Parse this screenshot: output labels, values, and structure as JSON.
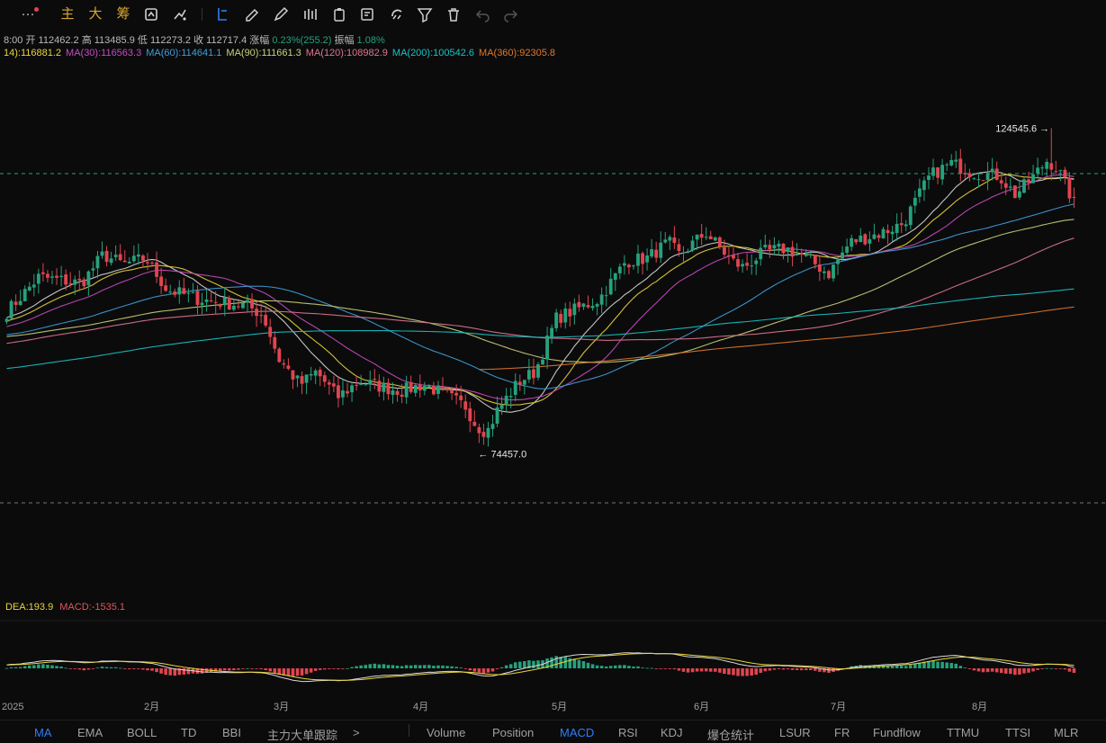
{
  "toolbar": {
    "items": [
      {
        "name": "more-menu",
        "label": "···"
      },
      {
        "name": "main-indicator",
        "label": "主"
      },
      {
        "name": "big-order",
        "label": "大"
      },
      {
        "name": "chip-distribution",
        "label": "筹"
      }
    ],
    "icons": [
      "compare-icon",
      "indicator-icon",
      "cursor-icon",
      "ruler-icon",
      "pen-icon",
      "pattern-icon",
      "clipboard-icon",
      "note-icon",
      "magnet-icon",
      "filter-icon",
      "trash-icon",
      "undo-icon",
      "redo-icon"
    ]
  },
  "ohlc": {
    "time": "8:00",
    "open_label": "开",
    "open": "112462.2",
    "high_label": "高",
    "high": "113485.9",
    "low_label": "低",
    "low": "112273.2",
    "close_label": "收",
    "close": "112717.4",
    "change_label": "涨幅",
    "change": "0.23%(255.2)",
    "amp_label": "振幅",
    "amp": "1.08%"
  },
  "ma_legend": [
    {
      "text": "14):116881.2",
      "color": "#e8d63a"
    },
    {
      "text": "MA(30):116563.3",
      "color": "#c84bc0"
    },
    {
      "text": "MA(60):114641.1",
      "color": "#3f9fd8"
    },
    {
      "text": "MA(90):111661.3",
      "color": "#c9d27a"
    },
    {
      "text": "MA(120):108982.9",
      "color": "#e0758f"
    },
    {
      "text": "MA(200):100542.6",
      "color": "#18c4c4"
    },
    {
      "text": "MA(360):92305.8",
      "color": "#e0782c"
    }
  ],
  "macd_legend": {
    "dea": "DEA:193.9",
    "dea_color": "#e8d63a",
    "macd": "MACD:-1535.1",
    "macd_color": "#e0555a"
  },
  "annotations": {
    "high": "124545.6",
    "low": "74457.0"
  },
  "x_axis": {
    "labels": [
      "2025",
      "2月",
      "3月",
      "4月",
      "5月",
      "6月",
      "7月",
      "8月"
    ]
  },
  "bottom_tabs_left": [
    {
      "label": "MA",
      "active": true
    },
    {
      "label": "EMA",
      "active": false
    },
    {
      "label": "BOLL",
      "active": false
    },
    {
      "label": "TD",
      "active": false
    },
    {
      "label": "BBI",
      "active": false
    },
    {
      "label": "主力大单跟踪",
      "active": false
    },
    {
      "label": ">",
      "active": false
    }
  ],
  "bottom_tabs_right": [
    {
      "label": "Volume",
      "active": false
    },
    {
      "label": "Position",
      "active": false
    },
    {
      "label": "MACD",
      "active": true
    },
    {
      "label": "RSI",
      "active": false
    },
    {
      "label": "KDJ",
      "active": false
    },
    {
      "label": "爆仓统计",
      "active": false
    },
    {
      "label": "LSUR",
      "active": false
    },
    {
      "label": "FR",
      "active": false
    },
    {
      "label": "Fundflow",
      "active": false
    },
    {
      "label": "TTMU",
      "active": false
    },
    {
      "label": "TTSI",
      "active": false
    },
    {
      "label": "MLR",
      "active": false
    }
  ],
  "colors": {
    "up": "#26a17b",
    "down": "#e0454f",
    "background": "#0b0b0c",
    "macd_line": "#d9d9d9",
    "signal_line": "#e8d63a"
  },
  "chart_data": {
    "type": "candlestick",
    "title": "",
    "x": [
      "2025-01",
      "2025-02",
      "2025-03",
      "2025-04",
      "2025-05",
      "2025-06",
      "2025-07",
      "2025-08"
    ],
    "price_anchors": [
      {
        "month": "2025-01",
        "close": 94000
      },
      {
        "month": "2025-01 late",
        "close": 104000
      },
      {
        "month": "2025-02",
        "close": 98000
      },
      {
        "month": "2025-03",
        "close": 84000
      },
      {
        "month": "2025-04",
        "close": 83000
      },
      {
        "month": "2025-04 min",
        "close": 74457
      },
      {
        "month": "2025-05",
        "close": 97000
      },
      {
        "month": "2025-05 late",
        "close": 109000
      },
      {
        "month": "2025-06",
        "close": 105000
      },
      {
        "month": "2025-07",
        "close": 108000
      },
      {
        "month": "2025-07 mid",
        "close": 119000
      },
      {
        "month": "2025-08",
        "close": 115000
      },
      {
        "month": "2025-08 peak",
        "close": 124545.6
      },
      {
        "month": "2025-08 last",
        "close": 112717.4
      }
    ],
    "series": [
      {
        "name": "MA(30)",
        "latest": 116563.3
      },
      {
        "name": "MA(60)",
        "latest": 114641.1
      },
      {
        "name": "MA(90)",
        "latest": 111661.3
      },
      {
        "name": "MA(120)",
        "latest": 108982.9
      },
      {
        "name": "MA(200)",
        "latest": 100542.6
      },
      {
        "name": "MA(360)",
        "latest": 92305.8
      }
    ],
    "high": 124545.6,
    "low": 74457.0,
    "ylim": [
      68000,
      132000
    ]
  }
}
